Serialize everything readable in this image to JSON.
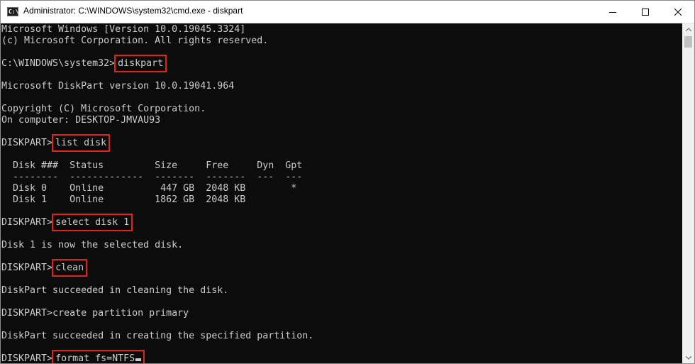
{
  "window": {
    "title": "Administrator: C:\\WINDOWS\\system32\\cmd.exe - diskpart",
    "icon": "cmd-icon",
    "icon_glyph": "C:\\",
    "controls": {
      "minimize": "minimize-icon",
      "maximize": "maximize-icon",
      "close": "close-icon"
    }
  },
  "console": {
    "lines": [
      {
        "text": "Microsoft Windows [Version 10.0.19045.3324]"
      },
      {
        "text": "(c) Microsoft Corporation. All rights reserved."
      },
      {
        "text": ""
      },
      {
        "prompt": "C:\\WINDOWS\\system32>",
        "command": "diskpart",
        "highlighted": true
      },
      {
        "text": ""
      },
      {
        "text": "Microsoft DiskPart version 10.0.19041.964"
      },
      {
        "text": ""
      },
      {
        "text": "Copyright (C) Microsoft Corporation."
      },
      {
        "text": "On computer: DESKTOP-JMVAU93"
      },
      {
        "text": ""
      },
      {
        "prompt": "DISKPART>",
        "command": "list disk",
        "highlighted": true
      },
      {
        "text": ""
      },
      {
        "text": "  Disk ###  Status         Size     Free     Dyn  Gpt"
      },
      {
        "text": "  --------  -------------  -------  -------  ---  ---"
      },
      {
        "text": "  Disk 0    Online          447 GB  2048 KB        *"
      },
      {
        "text": "  Disk 1    Online         1862 GB  2048 KB"
      },
      {
        "text": ""
      },
      {
        "prompt": "DISKPART>",
        "command": "select disk 1",
        "highlighted": true
      },
      {
        "text": ""
      },
      {
        "text": "Disk 1 is now the selected disk."
      },
      {
        "text": ""
      },
      {
        "prompt": "DISKPART>",
        "command": "clean",
        "highlighted": true
      },
      {
        "text": ""
      },
      {
        "text": "DiskPart succeeded in cleaning the disk."
      },
      {
        "text": ""
      },
      {
        "prompt": "DISKPART>",
        "command": "create partition primary",
        "highlighted": false
      },
      {
        "text": ""
      },
      {
        "text": "DiskPart succeeded in creating the specified partition."
      },
      {
        "text": ""
      },
      {
        "prompt": "DISKPART>",
        "command": "format fs=NTFS",
        "highlighted": true,
        "cursor": true
      }
    ],
    "colors": {
      "background": "#0c0c0c",
      "foreground": "#cccccc",
      "highlight": "#e2231a"
    }
  }
}
